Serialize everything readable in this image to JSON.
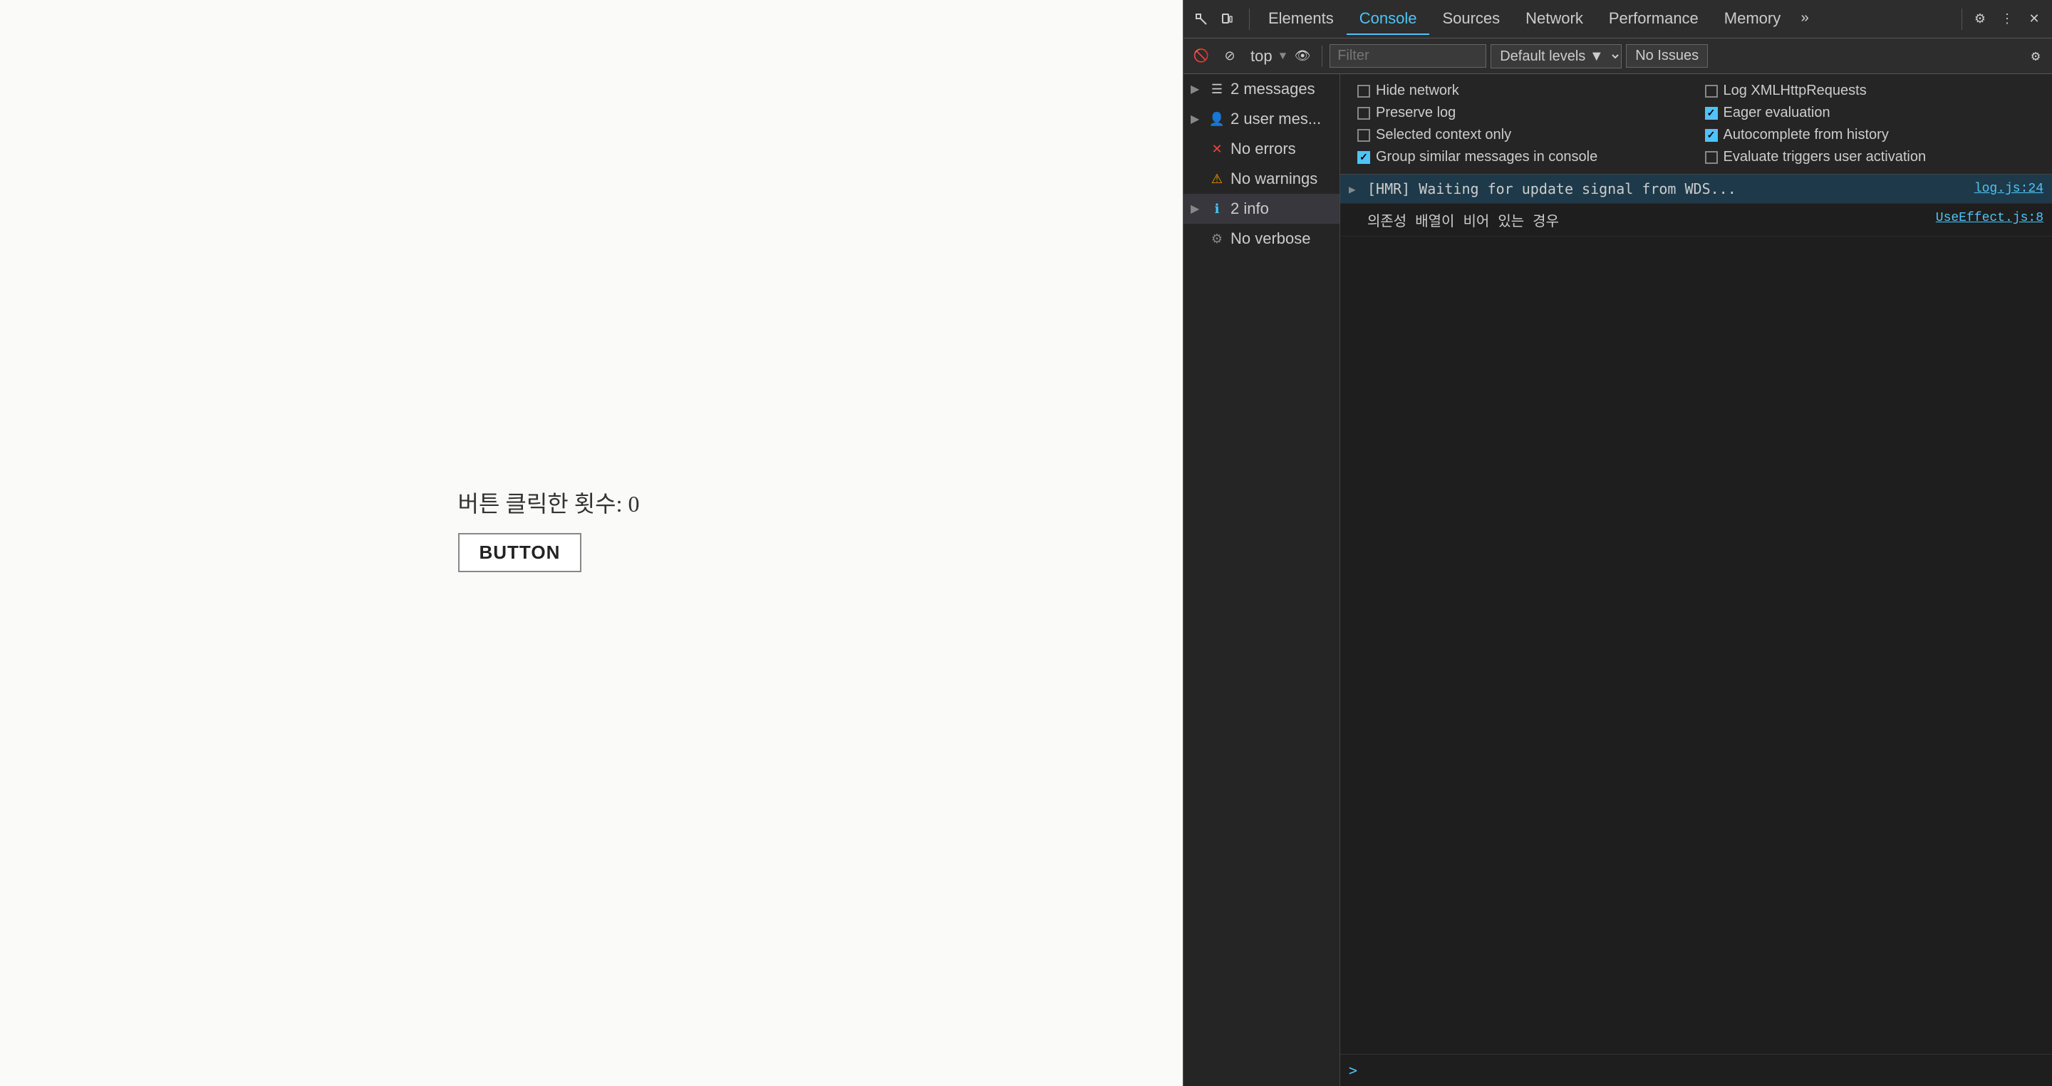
{
  "app": {
    "click_count_label": "버튼 클릭한 횟수: 0",
    "button_label": "BUTTON"
  },
  "devtools": {
    "tabs": [
      {
        "id": "elements",
        "label": "Elements",
        "active": false
      },
      {
        "id": "console",
        "label": "Console",
        "active": true
      },
      {
        "id": "sources",
        "label": "Sources",
        "active": false
      },
      {
        "id": "network",
        "label": "Network",
        "active": false
      },
      {
        "id": "performance",
        "label": "Performance",
        "active": false
      },
      {
        "id": "memory",
        "label": "Memory",
        "active": false
      }
    ],
    "toolbar": {
      "top_label": "top",
      "filter_placeholder": "Filter",
      "level_label": "Default levels ▼",
      "no_issues": "No Issues"
    },
    "sidebar": {
      "items": [
        {
          "id": "messages",
          "expand": "▶",
          "icon": "☰",
          "label": "2 messages",
          "type": "messages"
        },
        {
          "id": "user-messages",
          "expand": "▶",
          "icon": "👤",
          "label": "2 user mes...",
          "type": "user"
        },
        {
          "id": "errors",
          "expand": "",
          "icon": "✕",
          "label": "No errors",
          "type": "error"
        },
        {
          "id": "warnings",
          "expand": "",
          "icon": "⚠",
          "label": "No warnings",
          "type": "warning"
        },
        {
          "id": "info",
          "expand": "▶",
          "icon": "ℹ",
          "label": "2 info",
          "type": "info"
        },
        {
          "id": "verbose",
          "expand": "",
          "icon": "⚙",
          "label": "No verbose",
          "type": "verbose"
        }
      ]
    },
    "options": [
      {
        "id": "hide-network",
        "label": "Hide network",
        "checked": false
      },
      {
        "id": "log-xmlhttprequests",
        "label": "Log XMLHttpRequests",
        "checked": false
      },
      {
        "id": "preserve-log",
        "label": "Preserve log",
        "checked": false
      },
      {
        "id": "eager-evaluation",
        "label": "Eager evaluation",
        "checked": true
      },
      {
        "id": "selected-context-only",
        "label": "Selected context only",
        "checked": false
      },
      {
        "id": "autocomplete-from-history",
        "label": "Autocomplete from history",
        "checked": true
      },
      {
        "id": "group-similar-messages",
        "label": "Group similar messages in console",
        "checked": true
      },
      {
        "id": "evaluate-triggers",
        "label": "Evaluate triggers user activation",
        "checked": false
      }
    ],
    "log_entries": [
      {
        "id": "hmr-entry",
        "type": "info",
        "expand": "▶",
        "text": "[HMR] Waiting for update signal from WDS...",
        "source": "log.js:24"
      },
      {
        "id": "dependency-entry",
        "type": "warn",
        "expand": "",
        "text": "의존성 배열이 비어 있는 경우",
        "source": "UseEffect.js:8"
      }
    ],
    "prompt_arrow": ">"
  }
}
